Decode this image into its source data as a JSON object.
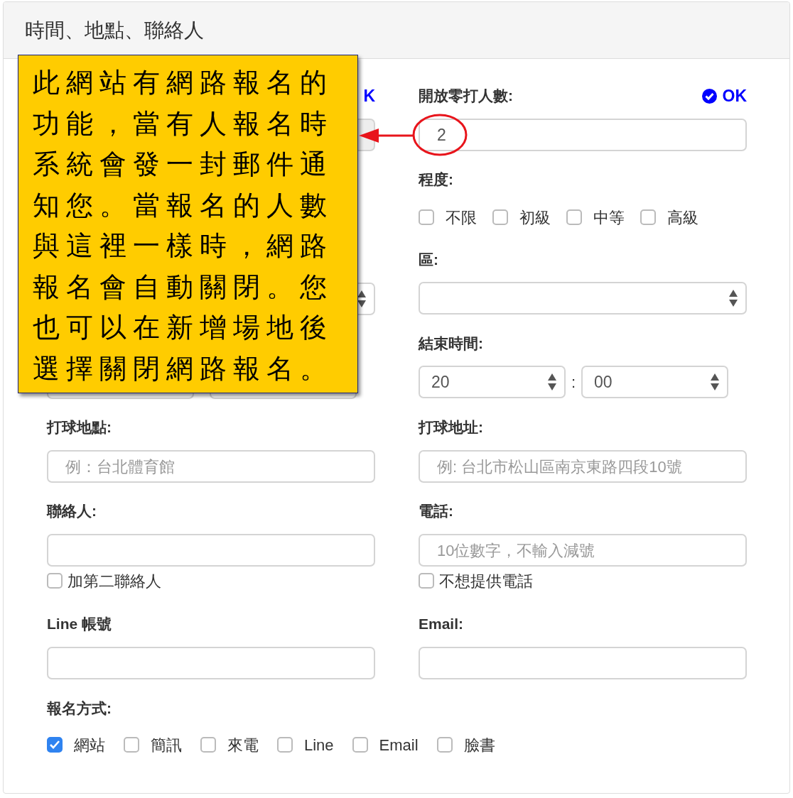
{
  "panel_title": "時間、地點、聯絡人",
  "callout": "此網站有網路報名的功能，當有人報名時系統會發一封郵件通知您。當報名的人數與這裡一樣時，網路報名會自動關閉。您也可以在新增場地後選擇關閉網路報名。",
  "covered_column": {
    "status": "K",
    "input_disabled": true
  },
  "players": {
    "label": "開放零打人數:",
    "status": "OK",
    "value": "2"
  },
  "level": {
    "label": "程度:",
    "options": [
      {
        "label": "不限",
        "checked": false
      },
      {
        "label": "初級",
        "checked": false
      },
      {
        "label": "中等",
        "checked": false
      },
      {
        "label": "高級",
        "checked": false
      }
    ]
  },
  "area": {
    "label": "區:"
  },
  "end_time": {
    "label": "結束時間:",
    "hour": "20",
    "separator": ":",
    "minute": "00"
  },
  "fields": [
    {
      "label": "打球地點:",
      "placeholder": "例：台北體育館"
    },
    {
      "label": "打球地址:",
      "placeholder": "例: 台北市松山區南京東路四段10號"
    },
    {
      "label": "聯絡人:",
      "checkbox": {
        "label": "加第二聯絡人",
        "checked": false
      }
    },
    {
      "label": "電話:",
      "placeholder": "10位數字，不輸入減號",
      "checkbox": {
        "label": "不想提供電話",
        "checked": false
      }
    },
    {
      "label": "Line 帳號"
    },
    {
      "label": "Email:"
    }
  ],
  "signup": {
    "label": "報名方式:",
    "options": [
      {
        "label": "網站",
        "checked": true
      },
      {
        "label": "簡訊",
        "checked": false
      },
      {
        "label": "來電",
        "checked": false
      },
      {
        "label": "Line",
        "checked": false
      },
      {
        "label": "Email",
        "checked": false
      },
      {
        "label": "臉書",
        "checked": false
      }
    ]
  }
}
